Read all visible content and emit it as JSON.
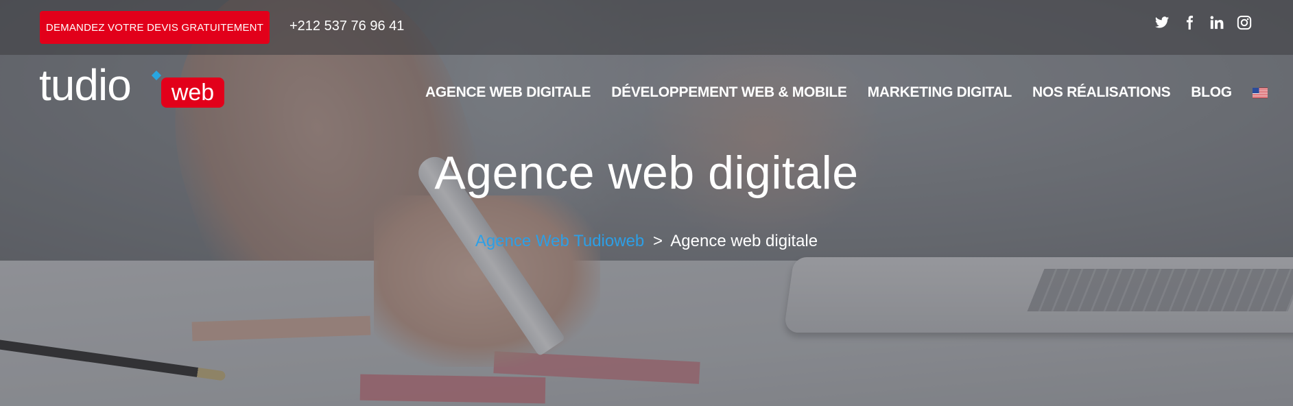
{
  "topbar": {
    "cta_label": "DEMANDEZ VOTRE DEVIS GRATUITEMENT",
    "phone": "+212 537 76 96 41",
    "social": [
      "twitter-icon",
      "facebook-icon",
      "linkedin-icon",
      "instagram-icon"
    ]
  },
  "logo": {
    "main": "tudio",
    "badge": "web"
  },
  "nav": {
    "items": [
      "AGENCE WEB DIGITALE",
      "DÉVELOPPEMENT WEB & MOBILE",
      "MARKETING DIGITAL",
      "NOS RÉALISATIONS",
      "BLOG"
    ],
    "language_icon": "us-flag-icon"
  },
  "hero": {
    "title": "Agence web digitale",
    "breadcrumb": {
      "home": "Agence Web Tudioweb",
      "separator": ">",
      "current": "Agence web digitale"
    }
  },
  "colors": {
    "accent_red": "#e2001a",
    "link_blue": "#2d9fe6",
    "logo_blue": "#28a6e0"
  }
}
